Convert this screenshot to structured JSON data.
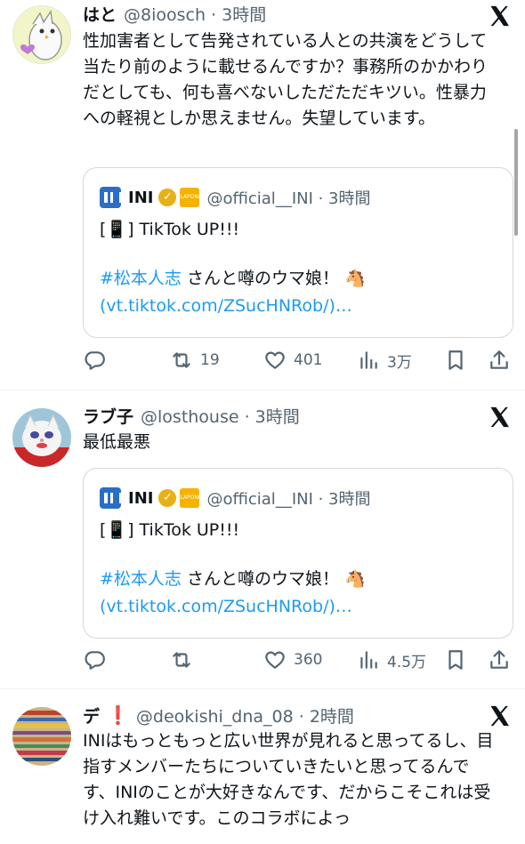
{
  "tweets": [
    {
      "display_name": "はと",
      "handle_time": "@8ioosch · 3時間",
      "text": "性加害者として告発されている人との共演をどうして当たり前のように載せるんですか？事務所のかかわりだとしても、何も喜べないしただただキツい。性暴力への軽視としか思えません。失望しています。",
      "quote": {
        "name": "INI",
        "handle_time": "@official__INI · 3時間",
        "line1": "[📱] TikTok UP!!!",
        "hashtag": "#松本人志",
        "line2_rest": " さんと噂のウマ娘！ 🐴",
        "link": "(vt.tiktok.com/ZSucHNRob/)…"
      },
      "actions": {
        "replies": "",
        "retweets": "19",
        "likes": "401",
        "views": "3万"
      }
    },
    {
      "display_name": "ラブ子",
      "handle_time": "@losthouse · 3時間",
      "text": "最低最悪",
      "quote": {
        "name": "INI",
        "handle_time": "@official__INI · 3時間",
        "line1": "[📱] TikTok UP!!!",
        "hashtag": "#松本人志",
        "line2_rest": " さんと噂のウマ娘！ 🐴",
        "link": "(vt.tiktok.com/ZSucHNRob/)…"
      },
      "actions": {
        "replies": "",
        "retweets": "",
        "likes": "360",
        "views": "4.5万"
      }
    },
    {
      "display_name": "デ",
      "badge": "❗",
      "handle_time": "@deokishi_dna_08 · 2時間",
      "text": "INIはもっともっと広い世界が見れると思ってるし、目指すメンバーたちについていきたいと思ってるんです、INIのことが大好きなんです、だからこそこれは受け入れ難いです。このコラボによっ"
    }
  ],
  "icons": {
    "x_logo": "x-logo-icon",
    "reply": "reply-icon",
    "retweet": "retweet-icon",
    "like": "heart-icon",
    "views": "views-icon",
    "bookmark": "bookmark-icon",
    "share": "share-icon"
  },
  "colors": {
    "link": "#1d9bf0",
    "meta": "#536471",
    "affiliate_badge": "#f5b300",
    "ini_logo": "#2a6ec7"
  }
}
